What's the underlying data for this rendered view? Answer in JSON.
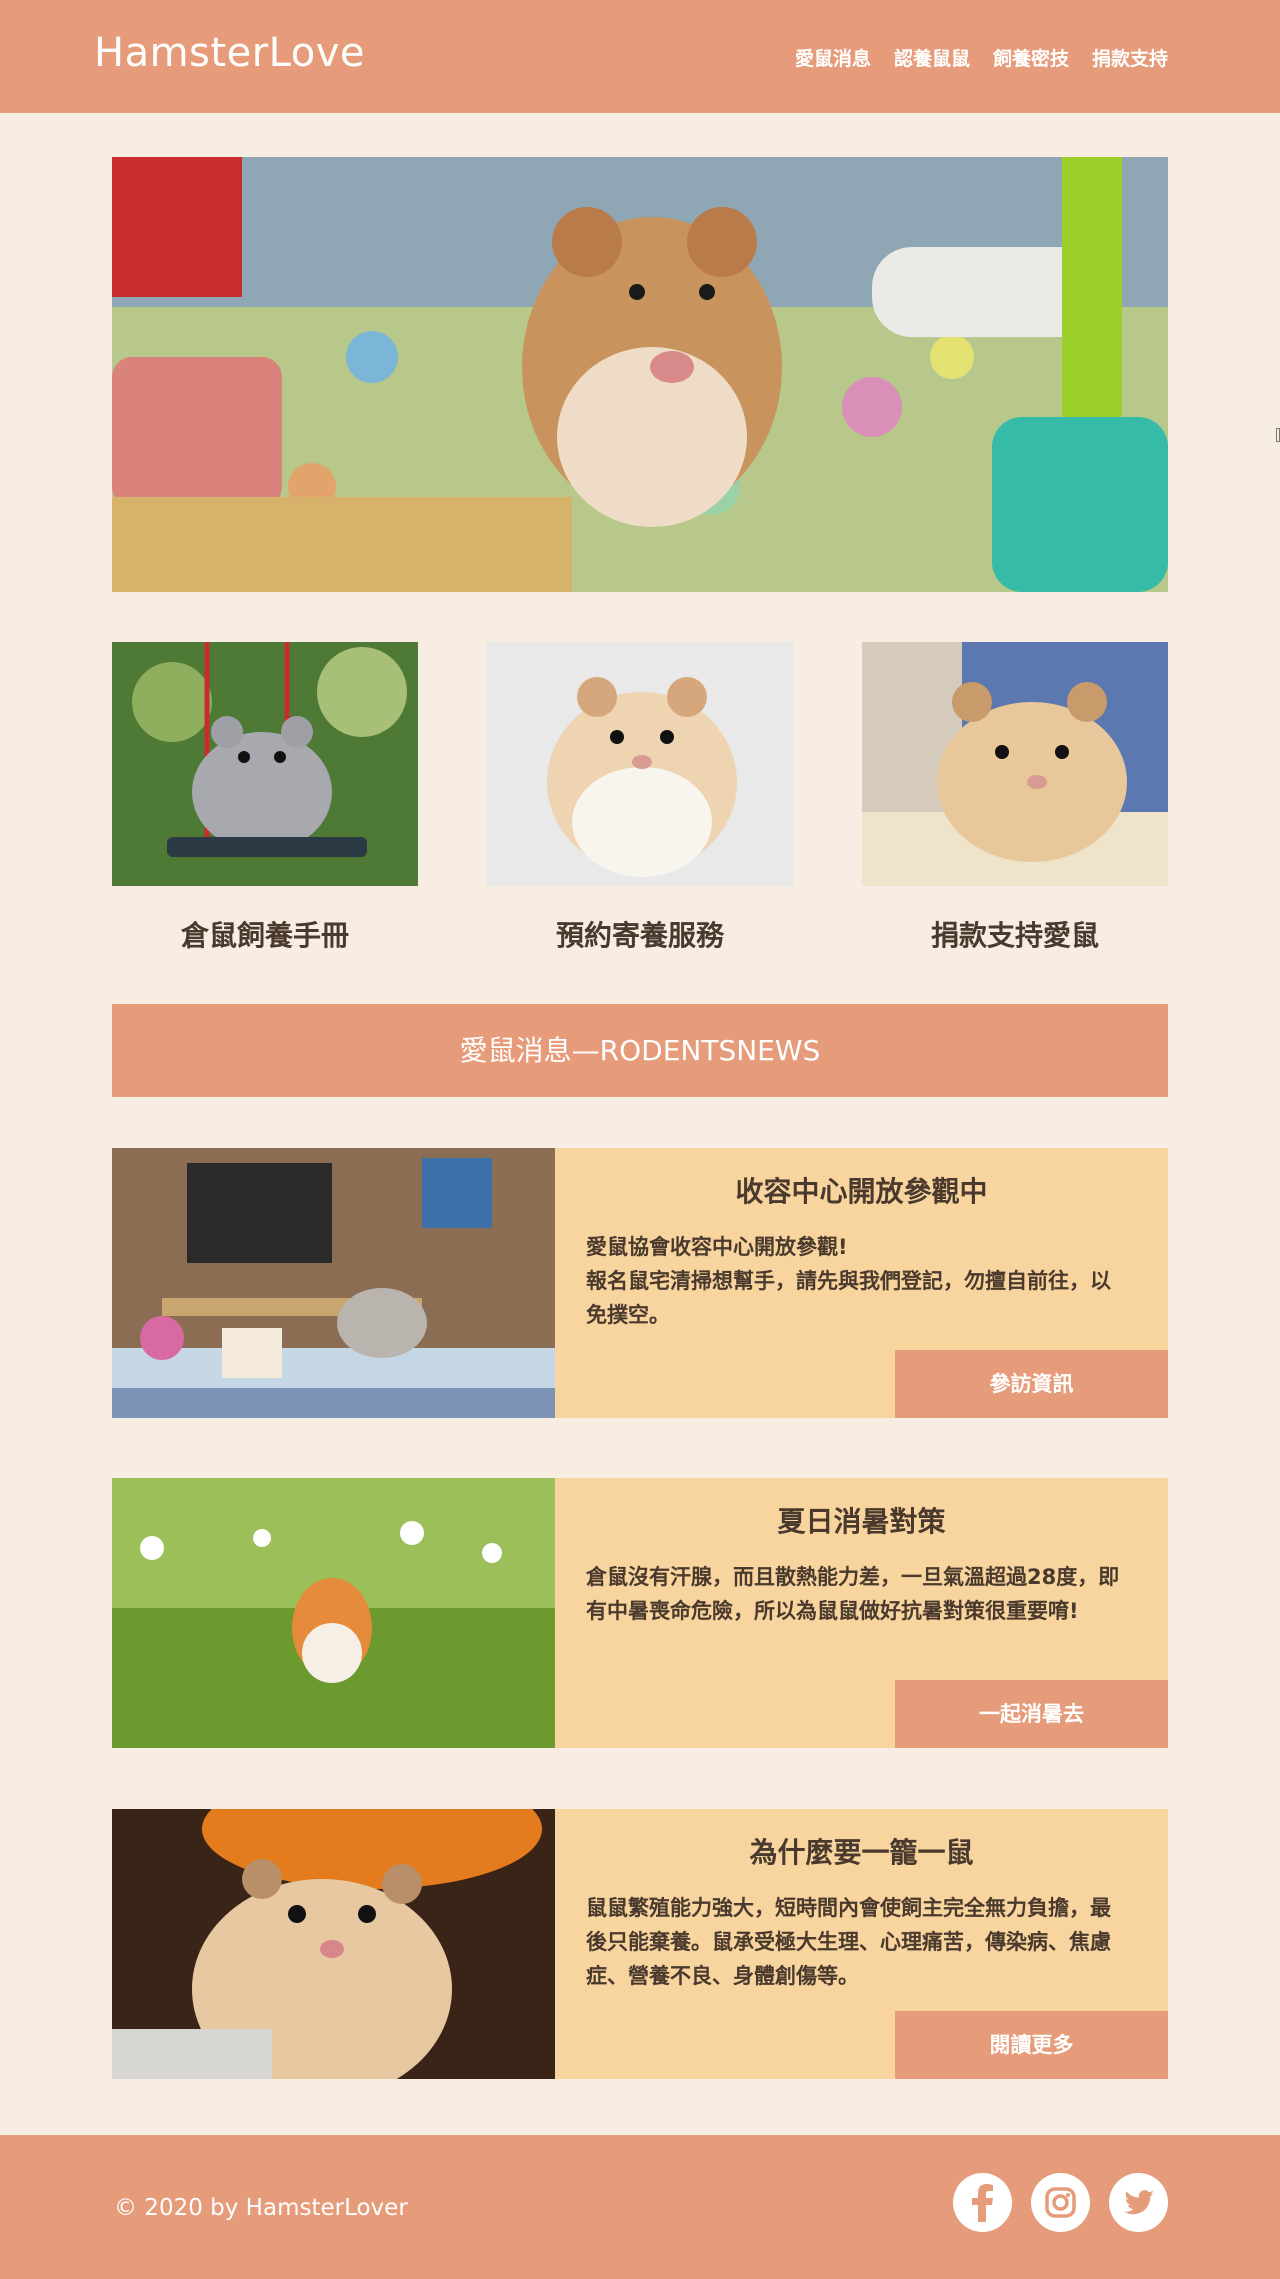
{
  "header": {
    "logo": "HamsterLove",
    "nav": [
      "愛鼠消息",
      "認養鼠鼠",
      "飼養密技",
      "捐款支持"
    ]
  },
  "cards": [
    {
      "title": "倉鼠飼養手冊"
    },
    {
      "title": "預約寄養服務"
    },
    {
      "title": "捐款支持愛鼠"
    }
  ],
  "banner": "愛鼠消息—RODENTSNEWS",
  "news": [
    {
      "title": "收容中心開放參觀中",
      "text": "愛鼠協會收容中心開放參觀!\n報名鼠宅清掃想幫手，請先與我們登記，勿擅自前往，以免撲空。",
      "button": "參訪資訊"
    },
    {
      "title": "夏日消暑對策",
      "text": "倉鼠沒有汗腺，而且散熱能力差，一旦氣溫超過28度，即有中暑喪命危險，所以為鼠鼠做好抗暑對策很重要唷!",
      "button": "一起消暑去"
    },
    {
      "title": "為什麼要一籠一鼠",
      "text": "鼠鼠繁殖能力強大，短時間內會使飼主完全無力負擔，最後只能棄養。鼠承受極大生理、心理痛苦，傳染病、焦慮症、營養不良、身體創傷等。",
      "button": "閱讀更多"
    }
  ],
  "footer": {
    "copyright": "© 2020 by HamsterLover",
    "social": [
      "facebook-icon",
      "instagram-icon",
      "twitter-icon"
    ]
  },
  "colors": {
    "accent": "#e69b7a",
    "card_bg": "#f8d49e",
    "page_bg": "#f7ede2",
    "text": "#4a3a2e"
  }
}
